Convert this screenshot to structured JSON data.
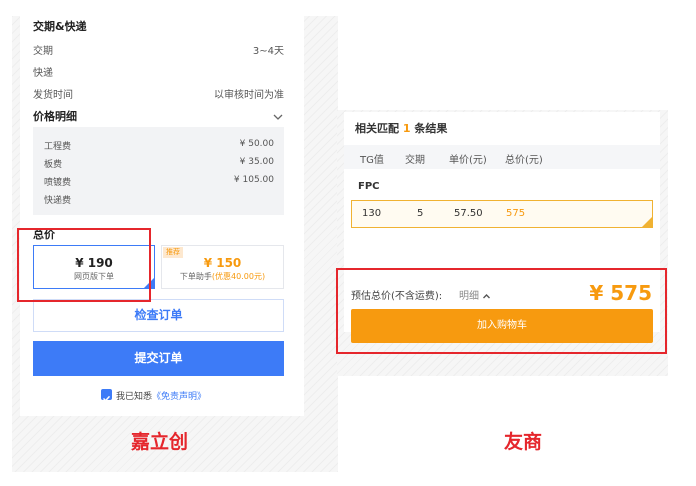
{
  "left": {
    "delivery": {
      "heading": "交期&快递",
      "rows": [
        {
          "label": "交期",
          "value": "3~4天"
        },
        {
          "label": "快递",
          "value": ""
        },
        {
          "label": "发货时间",
          "value": "以审核时间为准"
        }
      ]
    },
    "price_detail": {
      "heading": "价格明细",
      "fees": [
        {
          "label": "工程费",
          "value": "¥ 50.00"
        },
        {
          "label": "板费",
          "value": "¥ 35.00"
        },
        {
          "label": "喷镀费",
          "value": "¥ 105.00"
        },
        {
          "label": "快递费",
          "value": ""
        }
      ]
    },
    "total": {
      "heading": "总价",
      "options": [
        {
          "price": "¥ 190",
          "desc": "网页版下单"
        },
        {
          "badge": "推荐",
          "price": "¥ 150",
          "desc": "下单助手",
          "extra": "(优惠40.00元)"
        }
      ]
    },
    "check_order_label": "检查订单",
    "submit_order_label": "提交订单",
    "agree_prefix": "我已知悉",
    "disclaimer_link": "《免责声明》",
    "caption": "嘉立创"
  },
  "right": {
    "result": {
      "prefix": "相关匹配",
      "count": "1",
      "suffix": "条结果"
    },
    "columns": [
      "TG值",
      "交期",
      "单价(元)",
      "总价(元)"
    ],
    "group": "FPC",
    "row": {
      "tg": "130",
      "lead": "5",
      "unit": "57.50",
      "total": "575"
    },
    "estimate_label": "预估总价(不含运费):",
    "detail_label": "明细",
    "estimate_value": "¥ 575",
    "add_cart_label": "加入购物车",
    "caption": "友商"
  },
  "colors": {
    "accent_blue": "#3d7bf7",
    "orange": "#f79a0f",
    "highlight_red": "#e5262c",
    "link_blue": "#3d7bf7"
  }
}
